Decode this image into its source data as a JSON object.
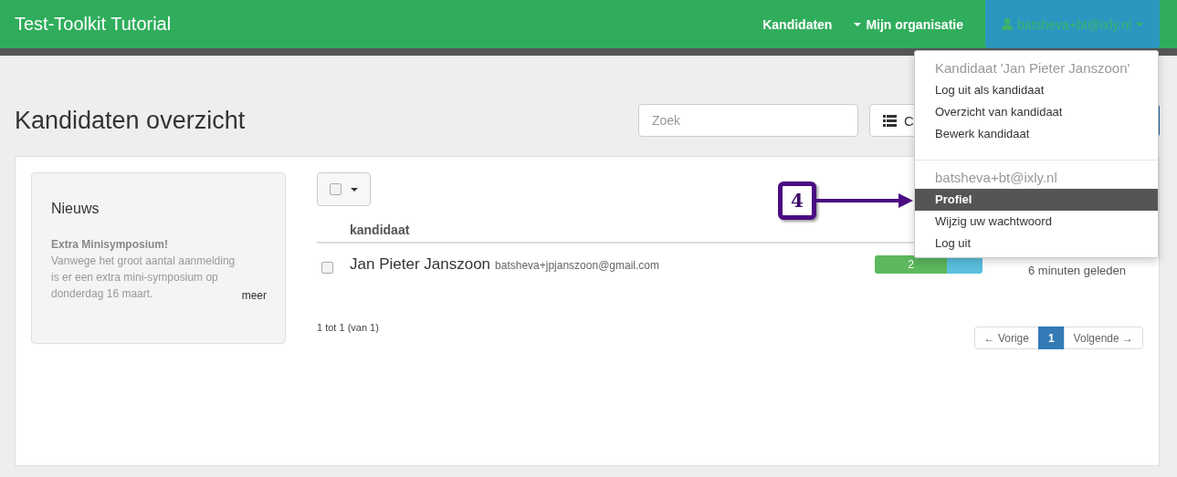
{
  "navbar": {
    "brand": "Test-Toolkit Tutorial",
    "links": [
      {
        "label": "Kandidaten",
        "caret": false
      },
      {
        "label": "Mijn organisatie",
        "caret": true
      }
    ],
    "user": "batsheva+bt@ixly.nl"
  },
  "header": {
    "title": "Kandidaten overzicht",
    "search": {
      "placeholder": "Zoek"
    },
    "button": "C"
  },
  "news": {
    "title": "Nieuws",
    "headline": "Extra Minisymposium!",
    "body": "Vanwege het groot aantal aanmelding is er een extra mini-symposium op donderdag 16 maart.",
    "more": "meer"
  },
  "table": {
    "select_all": {
      "checked": false
    },
    "columns": [
      "kandidaat"
    ],
    "rows": [
      {
        "checked": false,
        "name": "Jan Pieter Janszoon",
        "email": "batsheva+jpjanszoon@gmail.com",
        "progress": {
          "label": "2",
          "segments": [
            {
              "level": 0.67,
              "color": "#5cb85c"
            },
            {
              "level": 0.33,
              "color": "#5bc0de"
            }
          ]
        },
        "time": "6 minuten geleden"
      }
    ],
    "summary": "1 tot 1 (van 1)"
  },
  "pagination": [
    {
      "label": "← Vorige",
      "selected": false
    },
    {
      "label": "1",
      "selected": true
    },
    {
      "label": "Volgende →",
      "selected": false
    }
  ],
  "dropdown": {
    "sections": [
      {
        "header": "Kandidaat 'Jan Pieter Janszoon'",
        "items": [
          {
            "label": "Log uit als kandidaat",
            "selected": false
          },
          {
            "label": "Overzicht van kandidaat",
            "selected": false
          },
          {
            "label": "Bewerk kandidaat",
            "selected": false
          }
        ]
      },
      {
        "header": "batsheva+bt@ixly.nl",
        "items": [
          {
            "label": "Profiel",
            "selected": true
          },
          {
            "label": "Wijzig uw wachtwoord",
            "selected": false
          },
          {
            "label": "Log uit",
            "selected": false
          }
        ]
      }
    ]
  },
  "callout": {
    "label": "4"
  }
}
